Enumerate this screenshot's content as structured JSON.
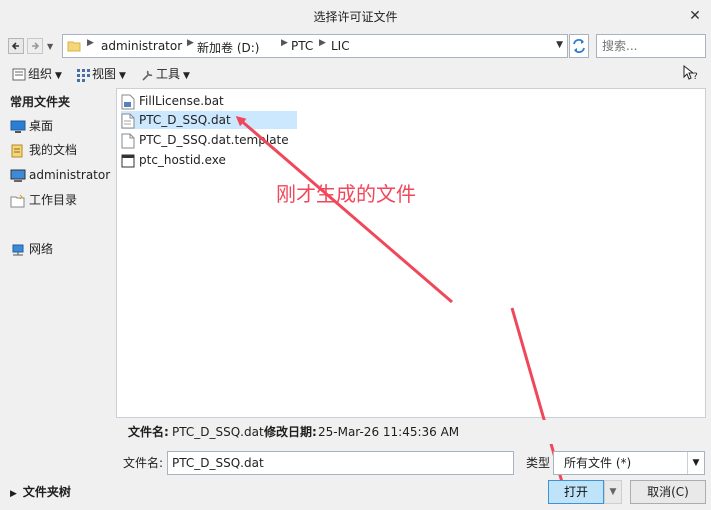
{
  "window": {
    "title": "选择许可证文件",
    "close": "✕"
  },
  "address": {
    "crumbs": [
      "administrator",
      "新加卷 (D:)",
      "PTC",
      "LIC"
    ],
    "search_placeholder": "搜索..."
  },
  "toolbar": {
    "organize": "组织",
    "view": "视图",
    "tools": "工具"
  },
  "sidebar": {
    "header": "常用文件夹",
    "items": [
      "桌面",
      "我的文档",
      "administrator",
      "工作目录",
      "网络"
    ],
    "folder_tree": "文件夹树"
  },
  "files": [
    {
      "name": "FillLicense.bat",
      "selected": false
    },
    {
      "name": "PTC_D_SSQ.dat",
      "selected": true
    },
    {
      "name": "PTC_D_SSQ.dat.template",
      "selected": false
    },
    {
      "name": "ptc_hostid.exe",
      "selected": false
    }
  ],
  "annotation": {
    "text": "刚才生成的文件",
    "color": "#f0475a"
  },
  "info": {
    "filename_label": "文件名:",
    "filename": "PTC_D_SSQ.dat",
    "modified_label": "修改日期:",
    "modified": "25-Mar-26 11:45:36 AM"
  },
  "form": {
    "filename_label": "文件名:",
    "filename_value": "PTC_D_SSQ.dat",
    "type_label": "类型",
    "type_value": "所有文件 (*)"
  },
  "buttons": {
    "open": "打开",
    "cancel": "取消(C)"
  },
  "colors": {
    "selection": "#cce8ff",
    "accent_button": "#bfe3f8",
    "annotation": "#f0475a"
  }
}
